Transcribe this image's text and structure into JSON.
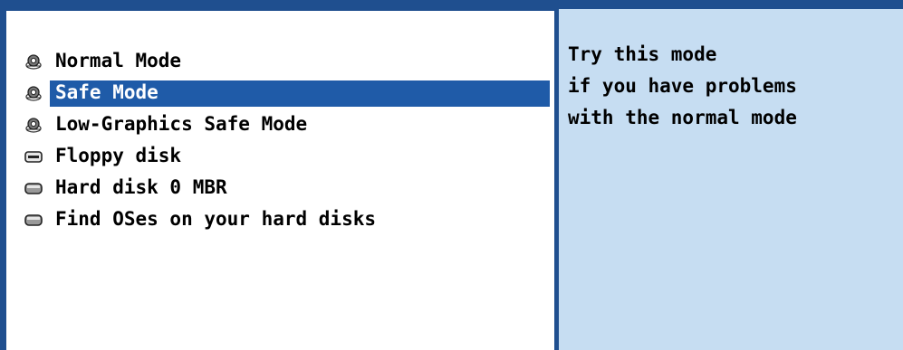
{
  "menu": {
    "items": [
      {
        "label": "Normal Mode",
        "icon": "gear-icon",
        "selected": false
      },
      {
        "label": "Safe Mode",
        "icon": "gear-icon",
        "selected": true
      },
      {
        "label": "Low-Graphics Safe Mode",
        "icon": "gear-icon",
        "selected": false
      },
      {
        "label": "Floppy disk",
        "icon": "floppy-disk-icon",
        "selected": false
      },
      {
        "label": "Hard disk 0 MBR",
        "icon": "hard-disk-icon",
        "selected": false
      },
      {
        "label": "Find OSes on your hard disks",
        "icon": "hard-disk-icon",
        "selected": false
      }
    ]
  },
  "description": {
    "lines": [
      "Try this mode",
      "if you have problems",
      "with the normal mode"
    ]
  },
  "colors": {
    "frame": "#1f4f8f",
    "selection": "#1f5ba8",
    "description_bg": "#c6ddf2",
    "menu_bg": "#ffffff"
  }
}
